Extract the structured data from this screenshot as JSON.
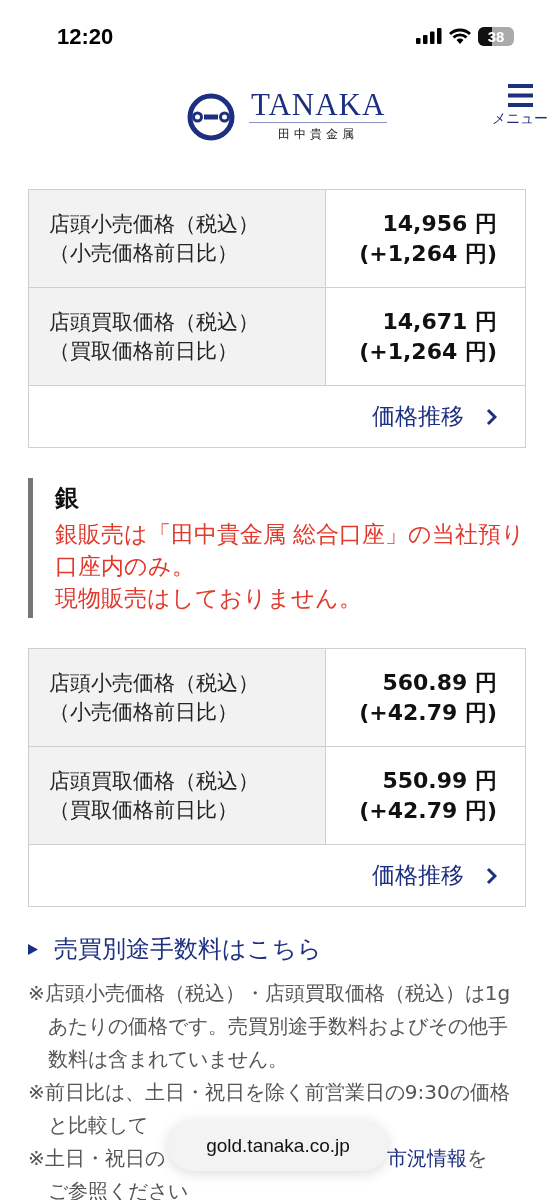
{
  "status_bar": {
    "time": "12:20",
    "battery": "38"
  },
  "header": {
    "logo_text": "TANAKA",
    "logo_subtitle": "田中貴金属",
    "menu_label": "メニュー"
  },
  "gold": {
    "rows": [
      {
        "label": "店頭小売価格（税込）",
        "sublabel": "（小売価格前日比）",
        "price": "14,956 円",
        "change": "(+1,264 円)"
      },
      {
        "label": "店頭買取価格（税込）",
        "sublabel": "（買取価格前日比）",
        "price": "14,671 円",
        "change": "(+1,264 円)"
      }
    ],
    "chart_link": "価格推移"
  },
  "silver": {
    "heading": "銀",
    "notice": [
      "銀販売は「田中貴金属 総合口座」の当社預り口座内のみ。",
      "現物販売はしておりません。"
    ],
    "rows": [
      {
        "label": "店頭小売価格（税込）",
        "sublabel": "（小売価格前日比）",
        "price": "560.89 円",
        "change": "(+42.79 円)"
      },
      {
        "label": "店頭買取価格（税込）",
        "sublabel": "（買取価格前日比）",
        "price": "550.99 円",
        "change": "(+42.79 円)"
      }
    ],
    "chart_link": "価格推移"
  },
  "fee_link": "売買別途手数料はこちら",
  "notes": [
    {
      "kind": "plain",
      "text": "※店頭小売価格（税込）・店頭買取価格（税込）は1gあたりの価格です。売買別途手数料およびその他手数料は含まれていません。"
    },
    {
      "kind": "plain",
      "text": "※前日比は、土日・祝日を除く前営業日の9:30の価格と比較して"
    },
    {
      "kind": "link",
      "before": "※土日・祝日の",
      "link": "市況情報",
      "after": "を",
      "next_line": "ご参照ください"
    }
  ],
  "url_pill": "gold.tanaka.co.jp"
}
